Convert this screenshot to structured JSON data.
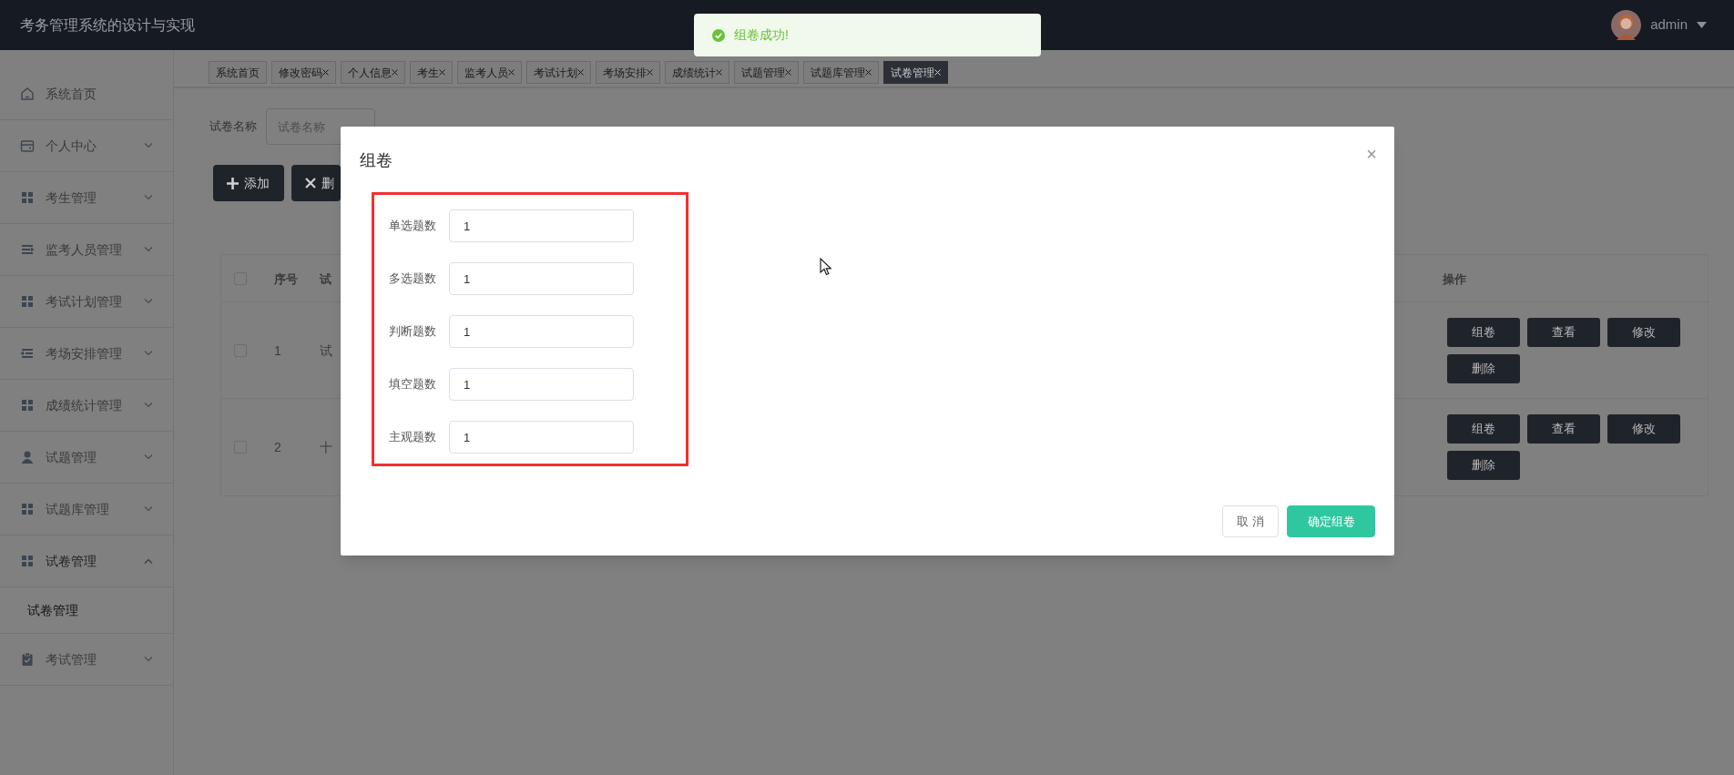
{
  "header": {
    "title": "考务管理系统的设计与实现",
    "user": {
      "name": "admin"
    }
  },
  "toast": {
    "text": "组卷成功!"
  },
  "sidebar": {
    "items": [
      {
        "label": "系统首页",
        "kind": "home",
        "expanded": false
      },
      {
        "label": "个人中心",
        "kind": "wallet",
        "expanded": false
      },
      {
        "label": "考生管理",
        "kind": "grid",
        "expanded": false
      },
      {
        "label": "监考人员管理",
        "kind": "list",
        "expanded": false
      },
      {
        "label": "考试计划管理",
        "kind": "grid",
        "expanded": false
      },
      {
        "label": "考场安排管理",
        "kind": "indent",
        "expanded": false
      },
      {
        "label": "成绩统计管理",
        "kind": "grid",
        "expanded": false
      },
      {
        "label": "试题管理",
        "kind": "person",
        "expanded": false
      },
      {
        "label": "试题库管理",
        "kind": "grid",
        "expanded": false
      },
      {
        "label": "试卷管理",
        "kind": "grid",
        "expanded": true,
        "children": [
          {
            "label": "试卷管理",
            "selected": true
          }
        ]
      },
      {
        "label": "考试管理",
        "kind": "clipboard",
        "expanded": false
      }
    ]
  },
  "tabs": [
    {
      "label": "系统首页",
      "closable": false,
      "selected": false
    },
    {
      "label": "修改密码",
      "closable": true,
      "selected": false
    },
    {
      "label": "个人信息",
      "closable": true,
      "selected": false
    },
    {
      "label": "考生",
      "closable": true,
      "selected": false
    },
    {
      "label": "监考人员",
      "closable": true,
      "selected": false
    },
    {
      "label": "考试计划",
      "closable": true,
      "selected": false
    },
    {
      "label": "考场安排",
      "closable": true,
      "selected": false
    },
    {
      "label": "成绩统计",
      "closable": true,
      "selected": false
    },
    {
      "label": "试题管理",
      "closable": true,
      "selected": false
    },
    {
      "label": "试题库管理",
      "closable": true,
      "selected": false
    },
    {
      "label": "试卷管理",
      "closable": true,
      "selected": true
    }
  ],
  "filter": {
    "label": "试卷名称",
    "placeholder": "试卷名称"
  },
  "toolbar": [
    {
      "label": "添加",
      "kind": "add"
    },
    {
      "label": "删",
      "kind": "delete"
    }
  ],
  "table": {
    "all_checked": false,
    "columns": [
      "序号",
      "试",
      "操作"
    ],
    "rows": [
      {
        "checked": false,
        "cells": [
          "1",
          "试"
        ],
        "actions": [
          "组卷",
          "查看",
          "修改",
          "删除"
        ]
      },
      {
        "checked": false,
        "cells": [
          "2",
          "十"
        ],
        "actions": [
          "组卷",
          "查看",
          "修改",
          "删除"
        ]
      }
    ]
  },
  "dialog": {
    "title": "组卷",
    "close": "×",
    "fields": [
      {
        "label": "单选题数",
        "value": "1"
      },
      {
        "label": "多选题数",
        "value": "1"
      },
      {
        "label": "判断题数",
        "value": "1"
      },
      {
        "label": "填空题数",
        "value": "1"
      },
      {
        "label": "主观题数",
        "value": "1"
      }
    ],
    "buttons": [
      {
        "label": "取 消",
        "kind": "default"
      },
      {
        "label": "确定组卷",
        "kind": "primary"
      }
    ]
  }
}
